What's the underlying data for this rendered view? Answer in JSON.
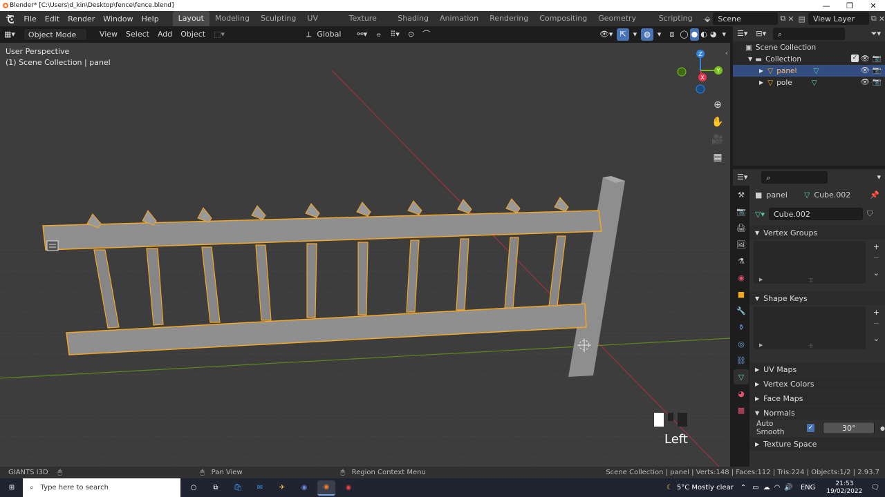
{
  "titlebar": {
    "title": "Blender* [C:\\Users\\d_kin\\Desktop\\fence\\fence.blend]",
    "minimize": "—",
    "maximize": "❐",
    "close": "✕"
  },
  "menu": [
    "File",
    "Edit",
    "Render",
    "Window",
    "Help"
  ],
  "workspaces": [
    "Layout",
    "Modeling",
    "Sculpting",
    "UV Editing",
    "Texture Paint",
    "Shading",
    "Animation",
    "Rendering",
    "Compositing",
    "Geometry Nodes",
    "Scripting"
  ],
  "scene": {
    "name": "Scene",
    "view_layer": "View Layer"
  },
  "viewport_header": {
    "mode": "Object Mode",
    "menus": [
      "View",
      "Select",
      "Add",
      "Object"
    ],
    "transform_orientation": "Global"
  },
  "viewport": {
    "perspective_label": "User Perspective",
    "collection_label": "(1) Scene Collection | panel",
    "view_name": "Left",
    "gizmo": {
      "x": "X",
      "y": "Y",
      "z": "Z"
    }
  },
  "outliner": {
    "root": "Scene Collection",
    "collection": "Collection",
    "objects": [
      {
        "name": "panel",
        "selected": true
      },
      {
        "name": "pole",
        "selected": false
      }
    ]
  },
  "properties": {
    "object_name": "panel",
    "mesh_name": "Cube.002",
    "data_field": "Cube.002",
    "panels": {
      "vertex_groups": "Vertex Groups",
      "shape_keys": "Shape Keys",
      "uv_maps": "UV Maps",
      "vertex_colors": "Vertex Colors",
      "face_maps": "Face Maps",
      "normals": "Normals",
      "auto_smooth_label": "Auto Smooth",
      "auto_smooth_angle": "30°",
      "texture_space": "Texture Space"
    }
  },
  "statusbar": {
    "left": "GIANTS I3D",
    "pan": "Pan View",
    "context": "Region Context Menu",
    "stats": "Scene Collection | panel | Verts:148 | Faces:112 | Tris:224 | Objects:1/2 | 2.93.7"
  },
  "taskbar": {
    "search_placeholder": "Type here to search",
    "weather": "5°C  Mostly clear",
    "lang": "ENG",
    "time": "21:53",
    "date": "19/02/2022"
  },
  "colors": {
    "accent_orange": "#f5a623",
    "selection_blue": "#334d80",
    "x_axis": "#e8354f",
    "y_axis": "#7bbf1d",
    "z_axis": "#2f84e3"
  }
}
